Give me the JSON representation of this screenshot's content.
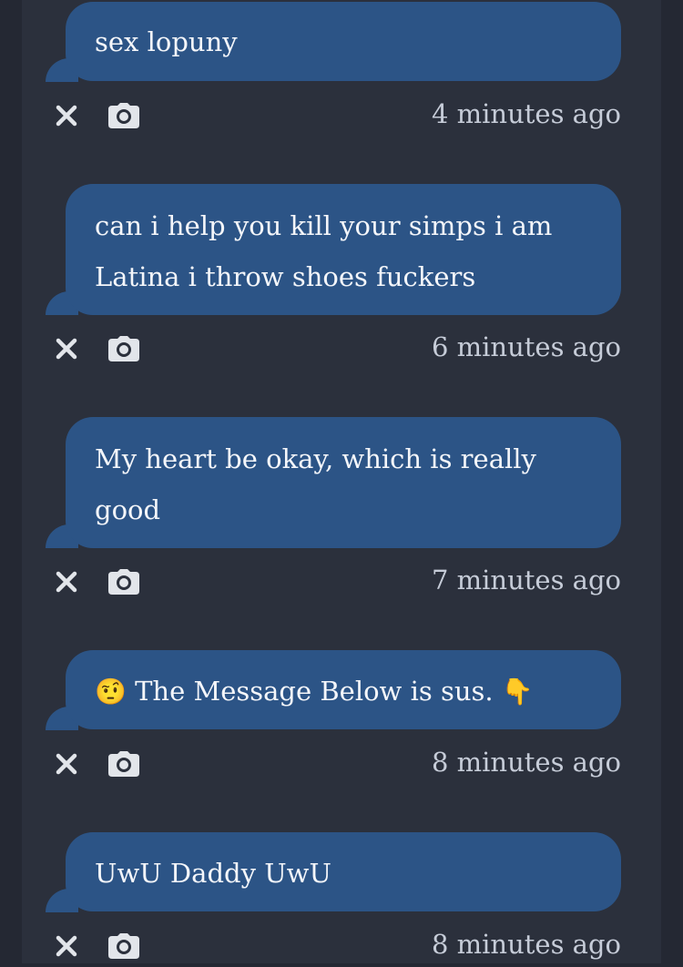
{
  "messages": [
    {
      "text": "sex lopuny",
      "time": "4 minutes ago"
    },
    {
      "text": "can i help you kill your simps i am Latina i throw shoes fuckers",
      "time": "6 minutes ago"
    },
    {
      "text": "My heart be okay, which is really good",
      "time": "7 minutes ago"
    },
    {
      "emoji_start": "🤨",
      "text": "The Message Below is sus.",
      "emoji_end": "👇",
      "time": "8 minutes ago"
    },
    {
      "text": "UwU Daddy UwU",
      "time": "8 minutes ago"
    }
  ],
  "icons": {
    "dismiss": "close-icon",
    "screenshot": "camera-icon"
  },
  "colors": {
    "bubble": "#2c5486",
    "background": "#2b303c",
    "timestamp": "#c6ccd8"
  }
}
